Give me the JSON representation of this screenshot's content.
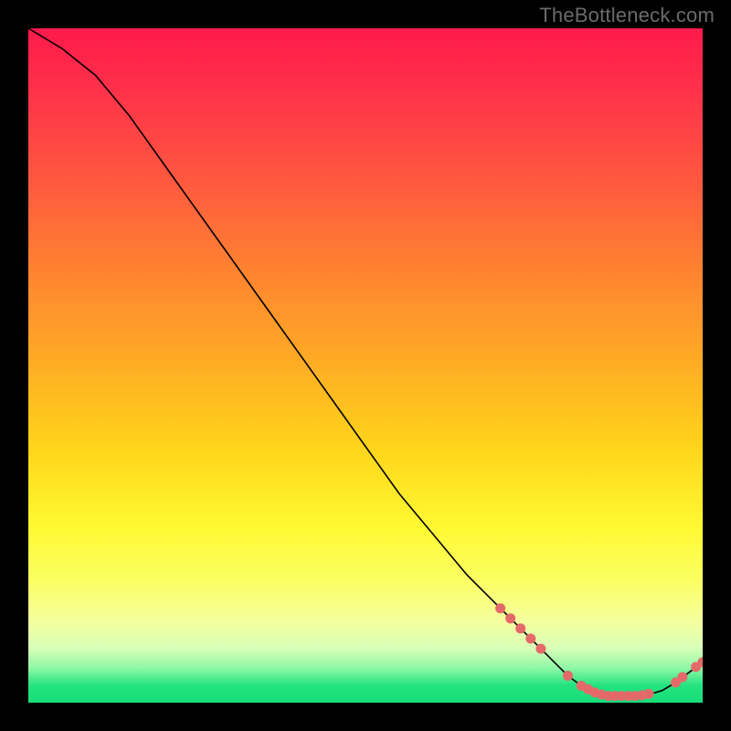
{
  "watermark": "TheBottleneck.com",
  "chart_data": {
    "type": "line",
    "title": "",
    "xlabel": "",
    "ylabel": "",
    "xlim": [
      0,
      100
    ],
    "ylim": [
      0,
      100
    ],
    "series": [
      {
        "name": "bottleneck-curve",
        "x": [
          0,
          5,
          10,
          15,
          20,
          25,
          30,
          35,
          40,
          45,
          50,
          55,
          60,
          65,
          70,
          75,
          78,
          80,
          82,
          84,
          86,
          88,
          90,
          92,
          94,
          96,
          98,
          100
        ],
        "y": [
          100,
          97,
          93,
          87,
          80,
          73,
          66,
          59,
          52,
          45,
          38,
          31,
          25,
          19,
          14,
          9,
          6,
          4,
          2.5,
          1.5,
          1,
          1,
          1,
          1.2,
          1.8,
          3,
          4.5,
          6
        ]
      }
    ],
    "scatter": {
      "name": "highlight-points",
      "points": [
        {
          "x": 70,
          "y": 14
        },
        {
          "x": 71.5,
          "y": 12.5
        },
        {
          "x": 73,
          "y": 11
        },
        {
          "x": 74.5,
          "y": 9.5
        },
        {
          "x": 76,
          "y": 8
        },
        {
          "x": 80,
          "y": 4
        },
        {
          "x": 82,
          "y": 2.5
        },
        {
          "x": 83,
          "y": 2
        },
        {
          "x": 84,
          "y": 1.5
        },
        {
          "x": 85,
          "y": 1.2
        },
        {
          "x": 86,
          "y": 1
        },
        {
          "x": 87,
          "y": 1
        },
        {
          "x": 88,
          "y": 1
        },
        {
          "x": 89,
          "y": 1
        },
        {
          "x": 90,
          "y": 1
        },
        {
          "x": 91,
          "y": 1.1
        },
        {
          "x": 92,
          "y": 1.3
        },
        {
          "x": 96,
          "y": 3
        },
        {
          "x": 97,
          "y": 3.8
        },
        {
          "x": 99,
          "y": 5.3
        },
        {
          "x": 100,
          "y": 6
        }
      ]
    },
    "background_gradient": {
      "top": "#ff1a4b",
      "mid_upper": "#ffad24",
      "mid_lower": "#fff932",
      "bottom": "#17dd78"
    }
  }
}
